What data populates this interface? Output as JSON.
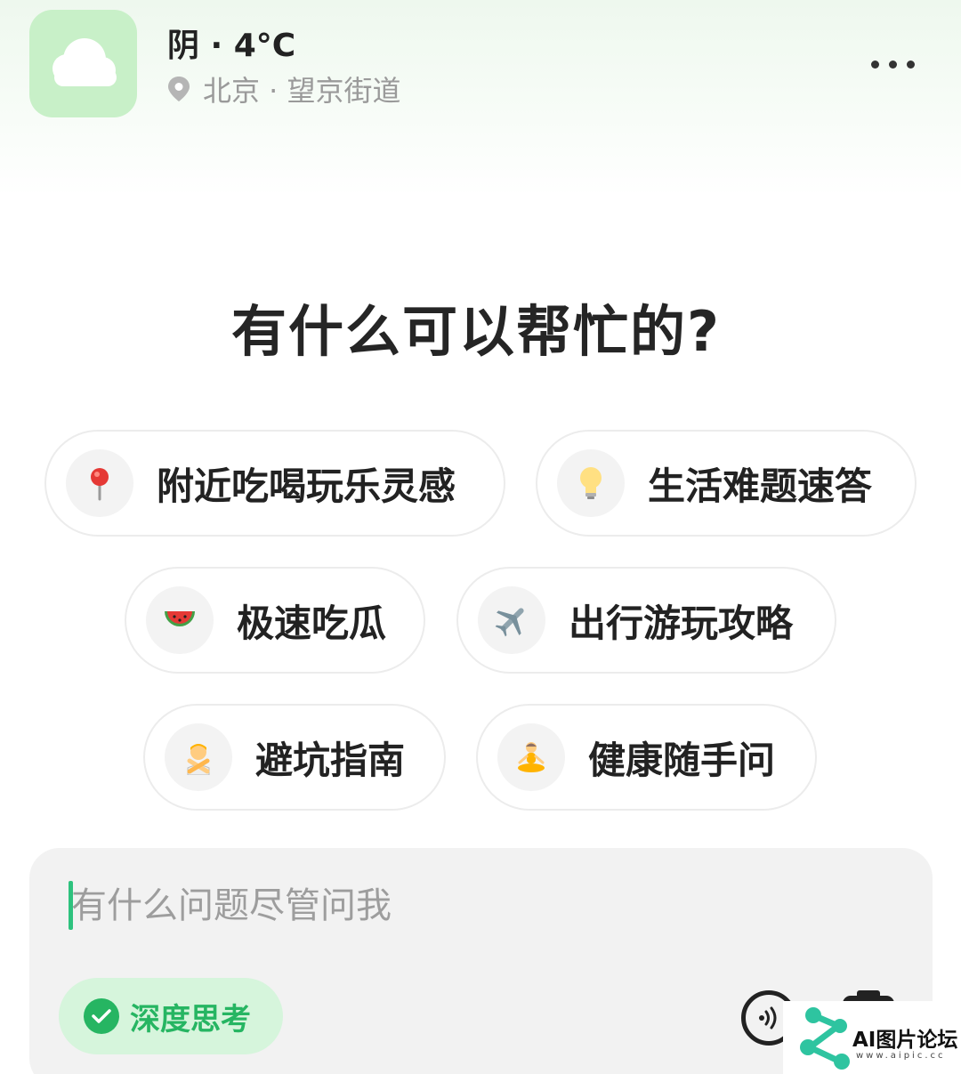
{
  "header": {
    "weather": "阴 · 4°C",
    "location": "北京 · 望京街道"
  },
  "headline": "有什么可以帮忙的?",
  "suggestions": [
    {
      "label": "附近吃喝玩乐灵感",
      "icon": "pin-icon"
    },
    {
      "label": "生活难题速答",
      "icon": "lightbulb-icon"
    },
    {
      "label": "极速吃瓜",
      "icon": "watermelon-icon"
    },
    {
      "label": "出行游玩攻略",
      "icon": "airplane-icon"
    },
    {
      "label": "避坑指南",
      "icon": "no-gesture-icon"
    },
    {
      "label": "健康随手问",
      "icon": "meditation-icon"
    }
  ],
  "composer": {
    "placeholder": "有什么问题尽管问我",
    "deep_think_label": "深度思考"
  },
  "watermark": {
    "text": "AI图片论坛",
    "url": "www.aipic.cc"
  },
  "colors": {
    "accent_green": "#26b562",
    "caret_green": "#2ec27e",
    "weather_tile": "#c8f0c8",
    "chip_border": "#ececec"
  }
}
